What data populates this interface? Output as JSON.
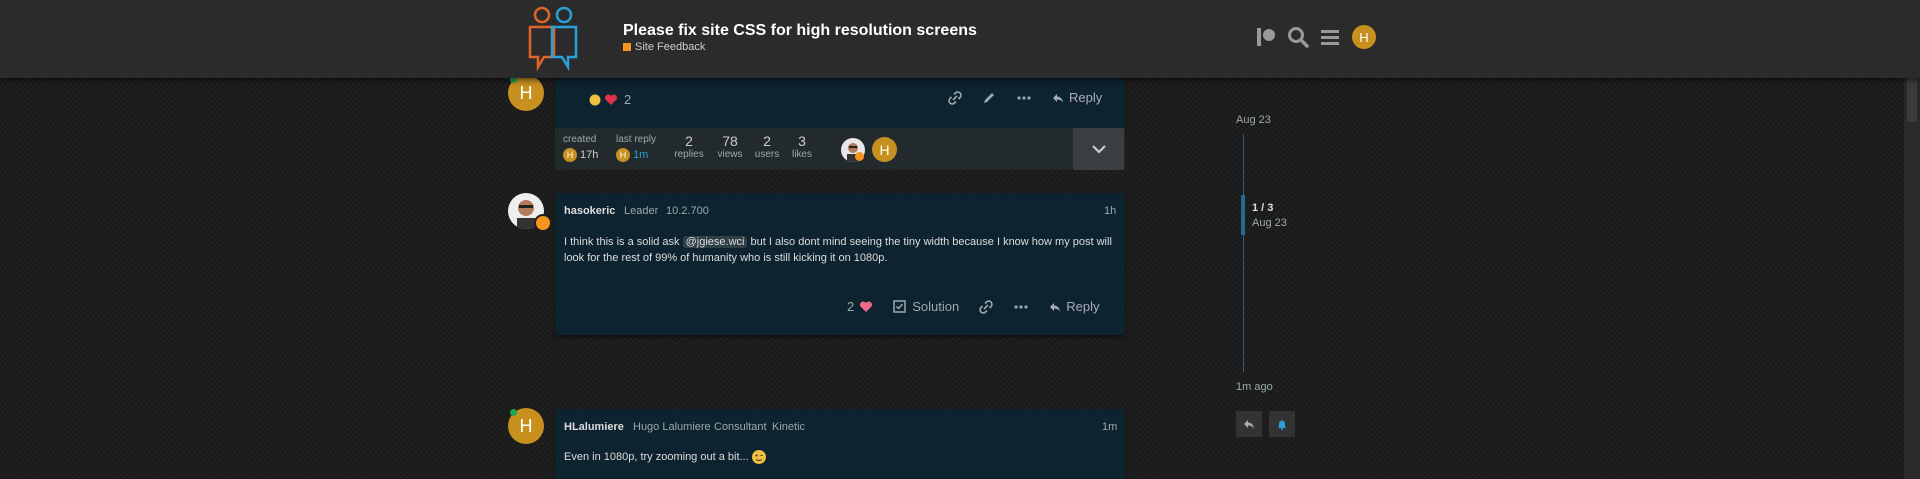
{
  "header": {
    "title": "Please fix site CSS for high resolution screens",
    "category": "Site Feedback",
    "category_color": "#f7941d",
    "user_initial": "H",
    "icons": [
      "patreon-icon",
      "search-icon",
      "hamburger-icon"
    ]
  },
  "first_post": {
    "avatar_initial": "H",
    "reactions_count": "2",
    "reply_label": "Reply",
    "stats": {
      "created_label": "created",
      "created_value": "17h",
      "last_reply_label": "last reply",
      "last_reply_value": "1m",
      "replies_value": "2",
      "replies_label": "replies",
      "views_value": "78",
      "views_label": "views",
      "users_value": "2",
      "users_label": "users",
      "likes_value": "3",
      "likes_label": "likes",
      "participant_initial": "H"
    }
  },
  "second_post": {
    "username": "hasokeric",
    "title": "Leader",
    "version": "10.2.700",
    "time": "1h",
    "text_before": "I think this is a solid ask ",
    "mention": "@jgiese.wci",
    "text_after_line1": " but I also dont mind seeing the tiny width because I know how my post will",
    "text_line2": "look for the rest of 99% of humanity who is still kicking it on 1080p.",
    "likes": "2",
    "solution_label": "Solution",
    "reply_label": "Reply"
  },
  "third_post": {
    "avatar_initial": "H",
    "username": "HLalumiere",
    "full_name": "Hugo Lalumiere",
    "title": "Consultant",
    "flair": "Kinetic",
    "time": "1m",
    "text": "Even in 1080p, try zooming out a bit... "
  },
  "timeline": {
    "top_date": "Aug 23",
    "position": "1 / 3",
    "position_date": "Aug 23",
    "bottom_label": "1m ago"
  }
}
